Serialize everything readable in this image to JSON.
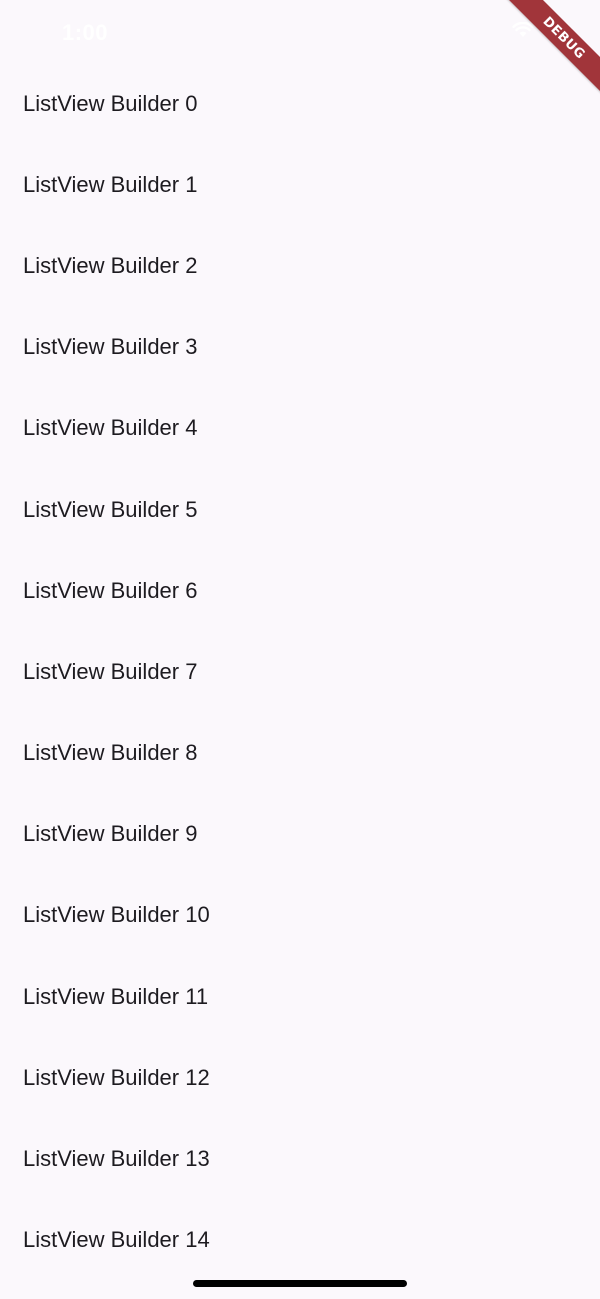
{
  "status_bar": {
    "time": "1:00",
    "wifi_icon": "wifi-icon",
    "battery_icon": "battery-icon"
  },
  "list": {
    "items": [
      {
        "label": "ListView Builder 0"
      },
      {
        "label": "ListView Builder 1"
      },
      {
        "label": "ListView Builder 2"
      },
      {
        "label": "ListView Builder 3"
      },
      {
        "label": "ListView Builder 4"
      },
      {
        "label": "ListView Builder 5"
      },
      {
        "label": "ListView Builder 6"
      },
      {
        "label": "ListView Builder 7"
      },
      {
        "label": "ListView Builder 8"
      },
      {
        "label": "ListView Builder 9"
      },
      {
        "label": "ListView Builder 10"
      },
      {
        "label": "ListView Builder 11"
      },
      {
        "label": "ListView Builder 12"
      },
      {
        "label": "ListView Builder 13"
      },
      {
        "label": "ListView Builder 14"
      }
    ]
  },
  "debug_banner": {
    "label": "DEBUG",
    "color": "#a1353a"
  },
  "colors": {
    "background": "#fbf8fc",
    "text": "#1d1b20"
  }
}
